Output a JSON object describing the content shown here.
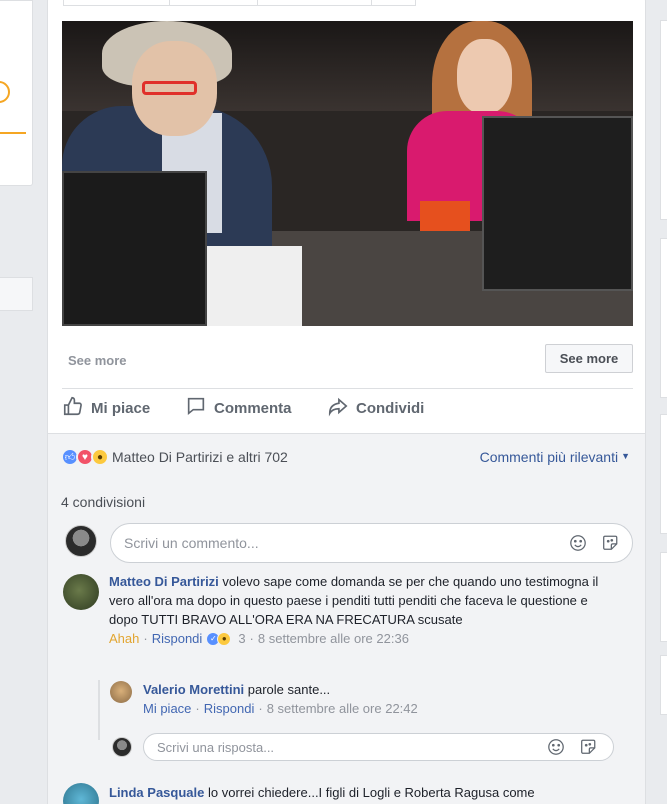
{
  "post": {
    "see_more_label": "See more",
    "see_more_button": "See more",
    "actions": {
      "like": "Mi piace",
      "comment": "Commenta",
      "share": "Condividi"
    }
  },
  "reactions": {
    "icons": [
      "like-reaction",
      "love-reaction",
      "wow-reaction"
    ],
    "summary": "Matteo Di Partirizi e altri 702",
    "sort_label": "Commenti più rilevanti",
    "shares": "4 condivisioni"
  },
  "composer": {
    "placeholder": "Scrivi un commento..."
  },
  "comments": [
    {
      "author": "Matteo Di Partirizi",
      "text": "volevo sape come domanda se per che quando uno testimogna il vero all'ora ma dopo in questo paese i penditi tutti penditi che faceva le questione e dopo TUTTI BRAVO ALL'ORA ERA NA FRECATURA scusate",
      "reaction_label": "Ahah",
      "reply_label": "Rispondi",
      "reaction_count": "3",
      "time": "8 settembre alle ore 22:36",
      "reply": {
        "author": "Valerio Morettini",
        "text": "parole sante...",
        "like_label": "Mi piace",
        "reply_label": "Rispondi",
        "time": "8 settembre alle ore 22:42"
      },
      "reply_placeholder": "Scrivi una risposta..."
    },
    {
      "author": "Linda Pasquale",
      "text": "lo vorrei chiedere...I figli di Logli e Roberta Ragusa come"
    }
  ],
  "separator": "·",
  "colors": {
    "link": "#365899",
    "secondary": "#90949c",
    "background": "#e9ebee",
    "comments_bg": "#f2f3f5"
  }
}
